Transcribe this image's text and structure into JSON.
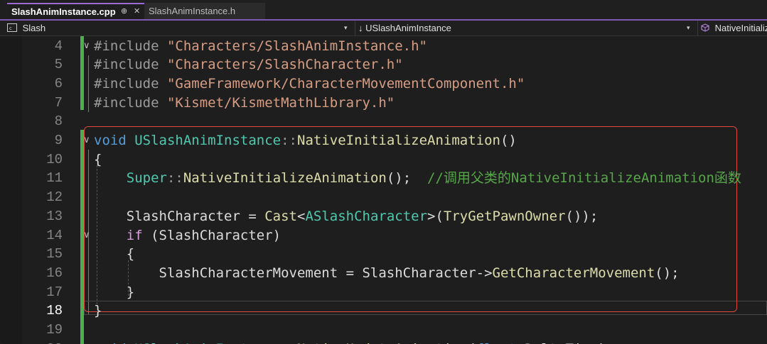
{
  "tabs": {
    "active": {
      "label": "SlashAnimInstance.cpp",
      "pin_glyph": "⊕",
      "close_glyph": "✕"
    },
    "inactive": {
      "label": "SlashAnimInstance.h"
    }
  },
  "navbar": {
    "project": "Slash",
    "scope": "USlashAnimInstance",
    "member": "NativeInitializeAnimation",
    "scope_arrow": "↓"
  },
  "colors": {
    "accent": "#9b6cd6",
    "highlight_box": "#e0483b",
    "change_bar": "#4caf50"
  },
  "editor": {
    "current_line": "18",
    "lines": [
      {
        "n": "4",
        "fold": "∨",
        "tokens": [
          {
            "t": "#include ",
            "c": "pp"
          },
          {
            "t": "\"Characters/SlashAnimInstance.h\"",
            "c": "str"
          }
        ]
      },
      {
        "n": "5",
        "fold": "",
        "tokens": [
          {
            "t": "#include ",
            "c": "pp"
          },
          {
            "t": "\"Characters/SlashCharacter.h\"",
            "c": "str"
          }
        ]
      },
      {
        "n": "6",
        "fold": "",
        "tokens": [
          {
            "t": "#include ",
            "c": "pp"
          },
          {
            "t": "\"GameFramework/CharacterMovementComponent.h\"",
            "c": "str"
          }
        ]
      },
      {
        "n": "7",
        "fold": "",
        "tokens": [
          {
            "t": "#include ",
            "c": "pp"
          },
          {
            "t": "\"Kismet/KismetMathLibrary.h\"",
            "c": "str"
          }
        ]
      },
      {
        "n": "8",
        "fold": "",
        "tokens": []
      },
      {
        "n": "9",
        "fold": "∨",
        "tokens": [
          {
            "t": "void ",
            "c": "kw"
          },
          {
            "t": "USlashAnimInstance",
            "c": "cls"
          },
          {
            "t": "::",
            "c": "pp"
          },
          {
            "t": "NativeInitializeAnimation",
            "c": "fn"
          },
          {
            "t": "()",
            "c": "ident"
          }
        ]
      },
      {
        "n": "10",
        "fold": "",
        "tokens": [
          {
            "t": "{",
            "c": "ident"
          }
        ]
      },
      {
        "n": "11",
        "fold": "",
        "tokens": [
          {
            "t": "    ",
            "c": "ident"
          },
          {
            "t": "Super",
            "c": "cls"
          },
          {
            "t": "::",
            "c": "pp"
          },
          {
            "t": "NativeInitializeAnimation",
            "c": "fn"
          },
          {
            "t": "();  ",
            "c": "ident"
          },
          {
            "t": "//调用父类的NativeInitializeAnimation函数",
            "c": "cmt"
          }
        ]
      },
      {
        "n": "12",
        "fold": "",
        "tokens": []
      },
      {
        "n": "13",
        "fold": "",
        "tokens": [
          {
            "t": "    SlashCharacter = ",
            "c": "ident"
          },
          {
            "t": "Cast",
            "c": "fn"
          },
          {
            "t": "<",
            "c": "ident"
          },
          {
            "t": "ASlashCharacter",
            "c": "cls"
          },
          {
            "t": ">(",
            "c": "ident"
          },
          {
            "t": "TryGetPawnOwner",
            "c": "fn"
          },
          {
            "t": "());",
            "c": "ident"
          }
        ]
      },
      {
        "n": "14",
        "fold": "∨",
        "tokens": [
          {
            "t": "    ",
            "c": "ident"
          },
          {
            "t": "if",
            "c": "ctl"
          },
          {
            "t": " (SlashCharacter)",
            "c": "ident"
          }
        ]
      },
      {
        "n": "15",
        "fold": "",
        "tokens": [
          {
            "t": "    {",
            "c": "ident"
          }
        ]
      },
      {
        "n": "16",
        "fold": "",
        "tokens": [
          {
            "t": "        SlashCharacterMovement = SlashCharacter->",
            "c": "ident"
          },
          {
            "t": "GetCharacterMovement",
            "c": "fn"
          },
          {
            "t": "();",
            "c": "ident"
          }
        ]
      },
      {
        "n": "17",
        "fold": "",
        "tokens": [
          {
            "t": "    }",
            "c": "ident"
          }
        ]
      },
      {
        "n": "18",
        "fold": "",
        "tokens": [
          {
            "t": "}",
            "c": "ident"
          }
        ]
      },
      {
        "n": "19",
        "fold": "",
        "tokens": []
      },
      {
        "n": "20",
        "fold": "∨",
        "tokens": [
          {
            "t": "void ",
            "c": "kw"
          },
          {
            "t": "USlashAnimInstance",
            "c": "cls"
          },
          {
            "t": "::",
            "c": "pp"
          },
          {
            "t": "NativeUpdateAnimation",
            "c": "fn"
          },
          {
            "t": "(",
            "c": "ident"
          },
          {
            "t": "float ",
            "c": "kw"
          },
          {
            "t": "DeltaTime)",
            "c": "ident"
          }
        ]
      }
    ]
  }
}
